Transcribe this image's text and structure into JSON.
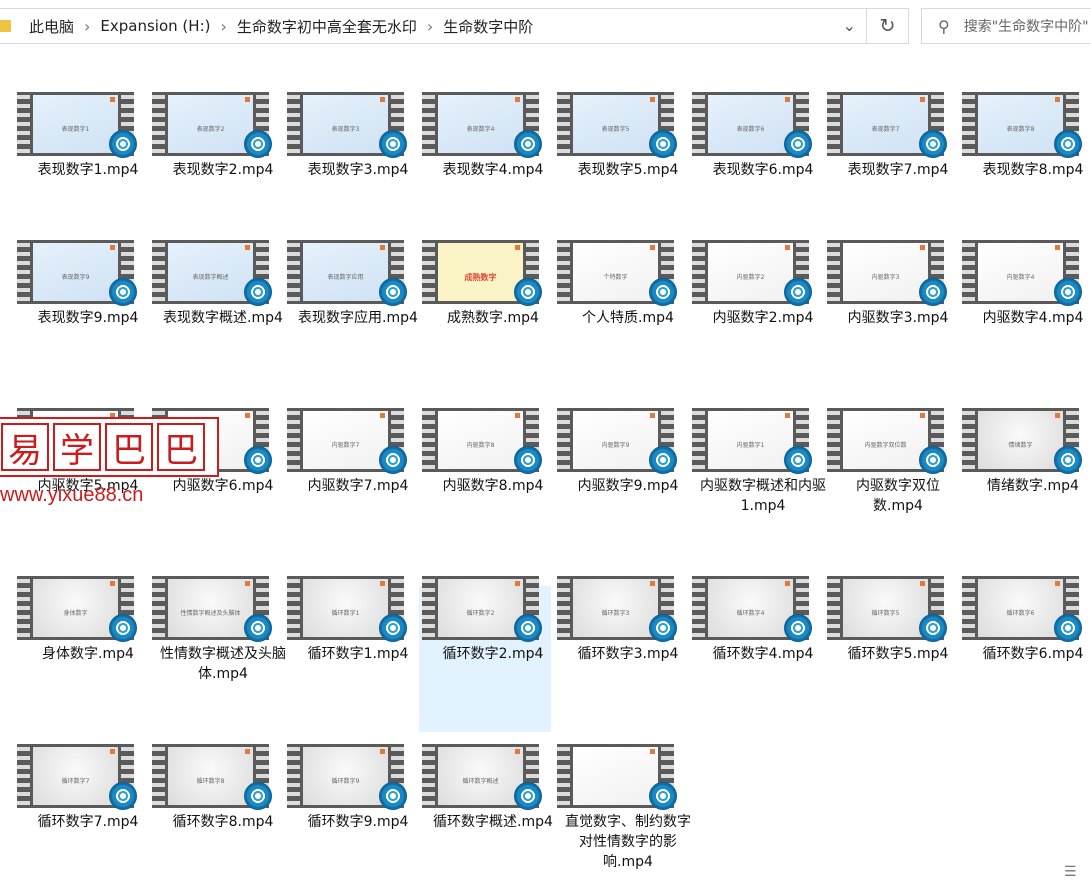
{
  "address_bar": {
    "breadcrumbs": [
      "此电脑",
      "Expansion (H:)",
      "生命数字初中高全套无水印",
      "生命数字中阶"
    ]
  },
  "search": {
    "placeholder": "搜索\"生命数字中阶\""
  },
  "watermark": {
    "chars": [
      "易",
      "学",
      "巴",
      "巴"
    ],
    "url": "www.yixue88.cn"
  },
  "files": [
    {
      "name": "表现数字1.mp4",
      "thumb_text": "表现数字1",
      "style": "blue"
    },
    {
      "name": "表现数字2.mp4",
      "thumb_text": "表现数字2",
      "style": "blue"
    },
    {
      "name": "表现数字3.mp4",
      "thumb_text": "表现数字3",
      "style": "blue"
    },
    {
      "name": "表现数字4.mp4",
      "thumb_text": "表现数字4",
      "style": "blue"
    },
    {
      "name": "表现数字5.mp4",
      "thumb_text": "表现数字5",
      "style": "blue"
    },
    {
      "name": "表现数字6.mp4",
      "thumb_text": "表现数字6",
      "style": "blue"
    },
    {
      "name": "表现数字7.mp4",
      "thumb_text": "表现数字7",
      "style": "blue"
    },
    {
      "name": "表现数字8.mp4",
      "thumb_text": "表现数字8",
      "style": "blue"
    },
    {
      "name": "表现数字9.mp4",
      "thumb_text": "表现数字9",
      "style": "blue"
    },
    {
      "name": "表现数字概述.mp4",
      "thumb_text": "表现数字概述",
      "style": "blue"
    },
    {
      "name": "表现数字应用.mp4",
      "thumb_text": "表现数字应用",
      "style": "blue"
    },
    {
      "name": "成熟数字.mp4",
      "thumb_text": "成熟数字",
      "style": "yellow"
    },
    {
      "name": "个人特质.mp4",
      "thumb_text": "个特数字",
      "style": "white"
    },
    {
      "name": "内驱数字2.mp4",
      "thumb_text": "内驱数字2",
      "style": "white"
    },
    {
      "name": "内驱数字3.mp4",
      "thumb_text": "内驱数字3",
      "style": "white"
    },
    {
      "name": "内驱数字4.mp4",
      "thumb_text": "内驱数字4",
      "style": "white"
    },
    {
      "name": "内驱数字5.mp4",
      "thumb_text": "",
      "style": "white"
    },
    {
      "name": "内驱数字6.mp4",
      "thumb_text": "",
      "style": "white"
    },
    {
      "name": "内驱数字7.mp4",
      "thumb_text": "内驱数字7",
      "style": "white"
    },
    {
      "name": "内驱数字8.mp4",
      "thumb_text": "内驱数字8",
      "style": "white"
    },
    {
      "name": "内驱数字9.mp4",
      "thumb_text": "内驱数字9",
      "style": "white"
    },
    {
      "name": "内驱数字概述和内驱1.mp4",
      "thumb_text": "内驱数字1",
      "style": "white"
    },
    {
      "name": "内驱数字双位数.mp4",
      "thumb_text": "内驱数字双位数",
      "style": "white"
    },
    {
      "name": "情绪数字.mp4",
      "thumb_text": "情绪数字",
      "style": "gray"
    },
    {
      "name": "身体数字.mp4",
      "thumb_text": "身体数字",
      "style": "gray"
    },
    {
      "name": "性情数字概述及头脑体.mp4",
      "thumb_text": "性情数字概述及头脑体",
      "style": "gray"
    },
    {
      "name": "循环数字1.mp4",
      "thumb_text": "循环数字1",
      "style": "gray"
    },
    {
      "name": "循环数字2.mp4",
      "thumb_text": "循环数字2",
      "style": "gray",
      "selected": true
    },
    {
      "name": "循环数字3.mp4",
      "thumb_text": "循环数字3",
      "style": "gray"
    },
    {
      "name": "循环数字4.mp4",
      "thumb_text": "循环数字4",
      "style": "gray"
    },
    {
      "name": "循环数字5.mp4",
      "thumb_text": "循环数字5",
      "style": "gray"
    },
    {
      "name": "循环数字6.mp4",
      "thumb_text": "循环数字6",
      "style": "gray"
    },
    {
      "name": "循环数字7.mp4",
      "thumb_text": "循环数字7",
      "style": "gray"
    },
    {
      "name": "循环数字8.mp4",
      "thumb_text": "循环数字8",
      "style": "gray"
    },
    {
      "name": "循环数字9.mp4",
      "thumb_text": "循环数字9",
      "style": "gray"
    },
    {
      "name": "循环数字概述.mp4",
      "thumb_text": "循环数字概述",
      "style": "gray"
    },
    {
      "name": "直觉数字、制约数字对性情数字的影响.mp4",
      "thumb_text": "",
      "style": "white"
    }
  ],
  "colors": {
    "selection": "#cce8ff",
    "watermark": "#cc1b1b",
    "folder": "#f0c440"
  },
  "icons": {
    "refresh": "refresh-icon",
    "search": "search-icon",
    "dropdown": "chevron-down-icon",
    "video": "media-player-icon"
  }
}
